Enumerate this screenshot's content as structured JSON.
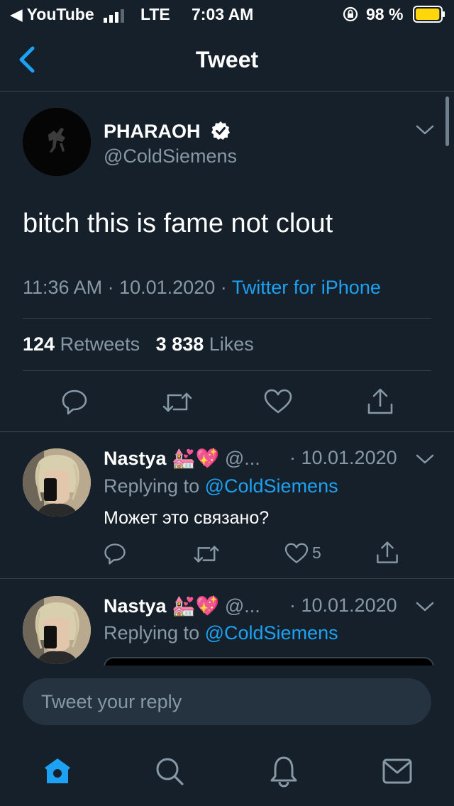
{
  "status_bar": {
    "back_app": "◀ YouTube",
    "network": "LTE",
    "time": "7:03 AM",
    "battery_percent": "98 %",
    "battery_level": 0.98,
    "signal_bars_filled": 3
  },
  "nav": {
    "title": "Tweet",
    "back_icon": "chevron-left-icon"
  },
  "tweet": {
    "author_name": "PHARAOH",
    "verified": true,
    "author_handle": "@ColdSiemens",
    "text": "bitch this is fame not clout",
    "time": "11:36 AM",
    "date": "10.01.2020",
    "source": "Twitter for iPhone",
    "retweets_count": "124",
    "retweets_label": "Retweets",
    "likes_count": "3 838",
    "likes_label": "Likes"
  },
  "replies": [
    {
      "name": "Nastya",
      "emojis": "💒💖",
      "handle": "@...",
      "date": "· 10.01.2020",
      "replying_label": "Replying to",
      "replying_handle": "@ColdSiemens",
      "text": "Может это связано?",
      "likes": "5"
    },
    {
      "name": "Nastya",
      "emojis": "💒💖",
      "handle": "@...",
      "date": "· 10.01.2020",
      "replying_label": "Replying to",
      "replying_handle": "@ColdSiemens"
    }
  ],
  "compose": {
    "placeholder": "Tweet your reply"
  },
  "tab_bar": {
    "items": [
      "home-icon",
      "search-icon",
      "notifications-icon",
      "messages-icon"
    ],
    "active": "home-icon"
  },
  "colors": {
    "background": "#15202b",
    "accent": "#1da1f2",
    "muted": "#8899a6",
    "divider": "#38444d",
    "battery": "#ffd60a"
  }
}
